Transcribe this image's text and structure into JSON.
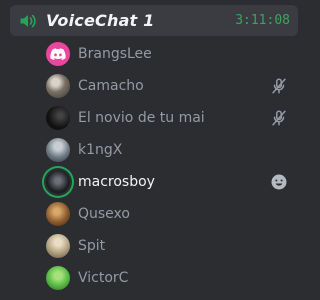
{
  "channel": {
    "name": "VoiceChat 1",
    "timer": "3:11:08",
    "icon": "speaker-icon",
    "accent": "#23a55a"
  },
  "users": [
    {
      "name": "BrangsLee",
      "avatar_color": "#eb459e",
      "avatar_icon": "discord-logo-icon"
    },
    {
      "name": "Camacho",
      "avatar_color": "#7a7066",
      "status_icon": "mic-muted-icon"
    },
    {
      "name": "El novio de tu mai",
      "avatar_color": "#111111",
      "status_icon": "mic-muted-icon"
    },
    {
      "name": "k1ngX",
      "avatar_color": "#6e7b85"
    },
    {
      "name": "macrosboy",
      "avatar_color": "#1d1f22",
      "speaking": true,
      "status_icon": "emoji-icon"
    },
    {
      "name": "Qusexo",
      "avatar_color": "#8a5a2b"
    },
    {
      "name": "Spit",
      "avatar_color": "#b9a888"
    },
    {
      "name": "VictorC",
      "avatar_color": "#5ec04a"
    }
  ]
}
